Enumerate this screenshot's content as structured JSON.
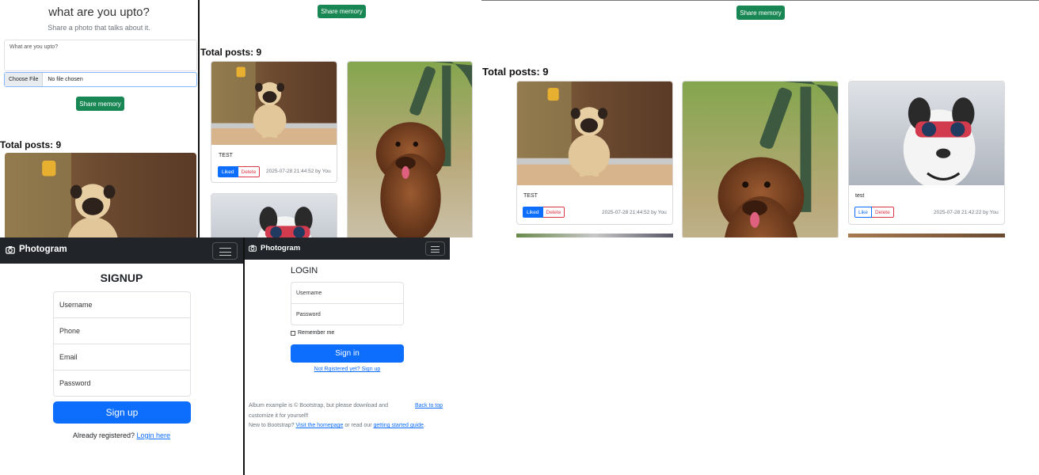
{
  "share_panel": {
    "title": "what are you upto?",
    "subtitle": "Share a photo that talks about it.",
    "textarea_placeholder": "What are you upto?",
    "choose_file_label": "Choose File",
    "no_file_label": "No file chosen",
    "share_button": "Share memory",
    "total_posts": "Total posts: 9"
  },
  "feed_middle": {
    "share_button": "Share memory",
    "total_posts": "Total posts: 9",
    "post1": {
      "caption": "TEST",
      "like_label": "Liked",
      "delete_label": "Delete",
      "meta": "2025-07-28 21:44:52 by You"
    }
  },
  "feed_right": {
    "share_button": "Share memory",
    "total_posts": "Total posts: 9",
    "post1": {
      "caption": "TEST",
      "like_label": "Liked",
      "delete_label": "Delete",
      "meta": "2025-07-28 21:44:52 by You"
    },
    "post3": {
      "caption": "test",
      "like_label": "Like",
      "delete_label": "Delete",
      "meta": "2025-07-28 21:42:22 by You"
    }
  },
  "signup": {
    "brand": "Photogram",
    "heading": "SIGNUP",
    "username_placeholder": "Username",
    "phone_placeholder": "Phone",
    "email_placeholder": "Email",
    "password_placeholder": "Password",
    "submit": "Sign up",
    "already_text": "Already registered?",
    "login_link": "Login here"
  },
  "login": {
    "brand": "Photogram",
    "heading": "LOGIN",
    "username_placeholder": "Username",
    "password_placeholder": "Password",
    "remember_label": "Remember me",
    "submit": "Sign in",
    "signup_link": "Not Rgistered yet? Sign up",
    "footer_line1": "Album example is © Bootstrap, but please download and",
    "footer_line2": "customize it for yourself!",
    "back_to_top": "Back to top",
    "footer_new": "New to Bootstrap?",
    "footer_visit": "Visit the homepage",
    "footer_or": "or read our",
    "footer_guide": "getting started guide",
    "footer_dot": "."
  },
  "colors": {
    "primary": "#0d6efd",
    "success": "#198754",
    "danger": "#dc3545",
    "dark": "#212529"
  }
}
